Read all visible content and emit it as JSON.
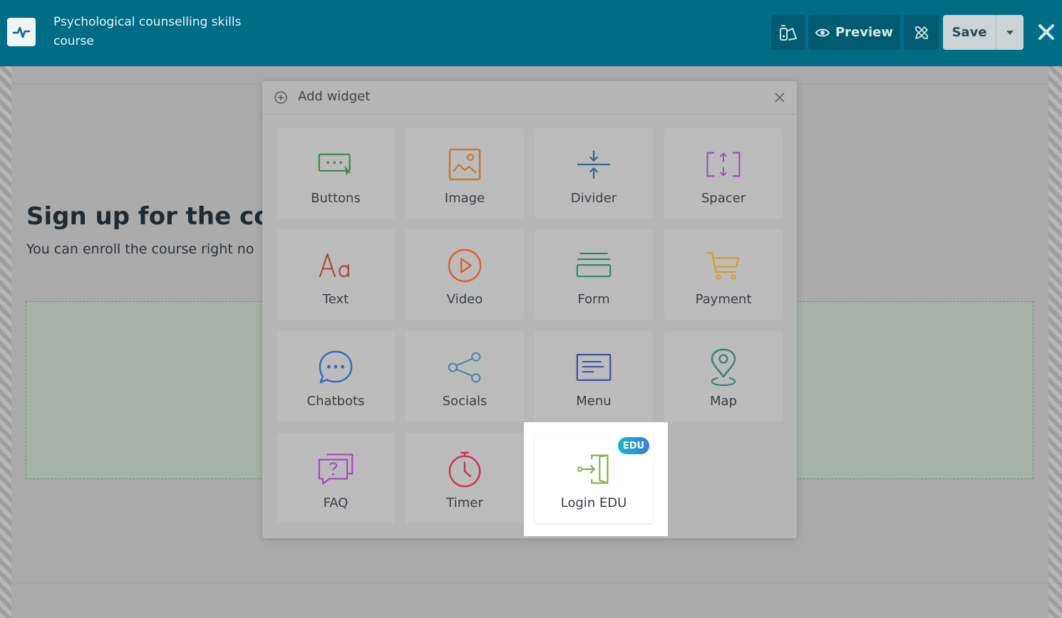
{
  "header": {
    "title": "Psychological counselling skills course",
    "preview_label": "Preview",
    "save_label": "Save",
    "colors": {
      "bar": "#006d87",
      "button": "#005a70"
    }
  },
  "page": {
    "heading": "Sign up for the cou",
    "subtext": "You can enroll the course right no"
  },
  "modal": {
    "title": "Add widget",
    "widgets": [
      {
        "label": "Buttons",
        "icon": "buttons-icon"
      },
      {
        "label": "Image",
        "icon": "image-icon"
      },
      {
        "label": "Divider",
        "icon": "divider-icon"
      },
      {
        "label": "Spacer",
        "icon": "spacer-icon"
      },
      {
        "label": "Text",
        "icon": "text-icon"
      },
      {
        "label": "Video",
        "icon": "video-icon"
      },
      {
        "label": "Form",
        "icon": "form-icon"
      },
      {
        "label": "Payment",
        "icon": "cart-icon"
      },
      {
        "label": "Chatbots",
        "icon": "chat-icon"
      },
      {
        "label": "Socials",
        "icon": "share-icon"
      },
      {
        "label": "Menu",
        "icon": "menu-icon"
      },
      {
        "label": "Map",
        "icon": "map-pin-icon"
      },
      {
        "label": "FAQ",
        "icon": "faq-icon"
      },
      {
        "label": "Timer",
        "icon": "timer-icon"
      },
      {
        "label": "Login EDU",
        "icon": "login-icon",
        "badge": "EDU",
        "highlighted": true
      }
    ]
  }
}
